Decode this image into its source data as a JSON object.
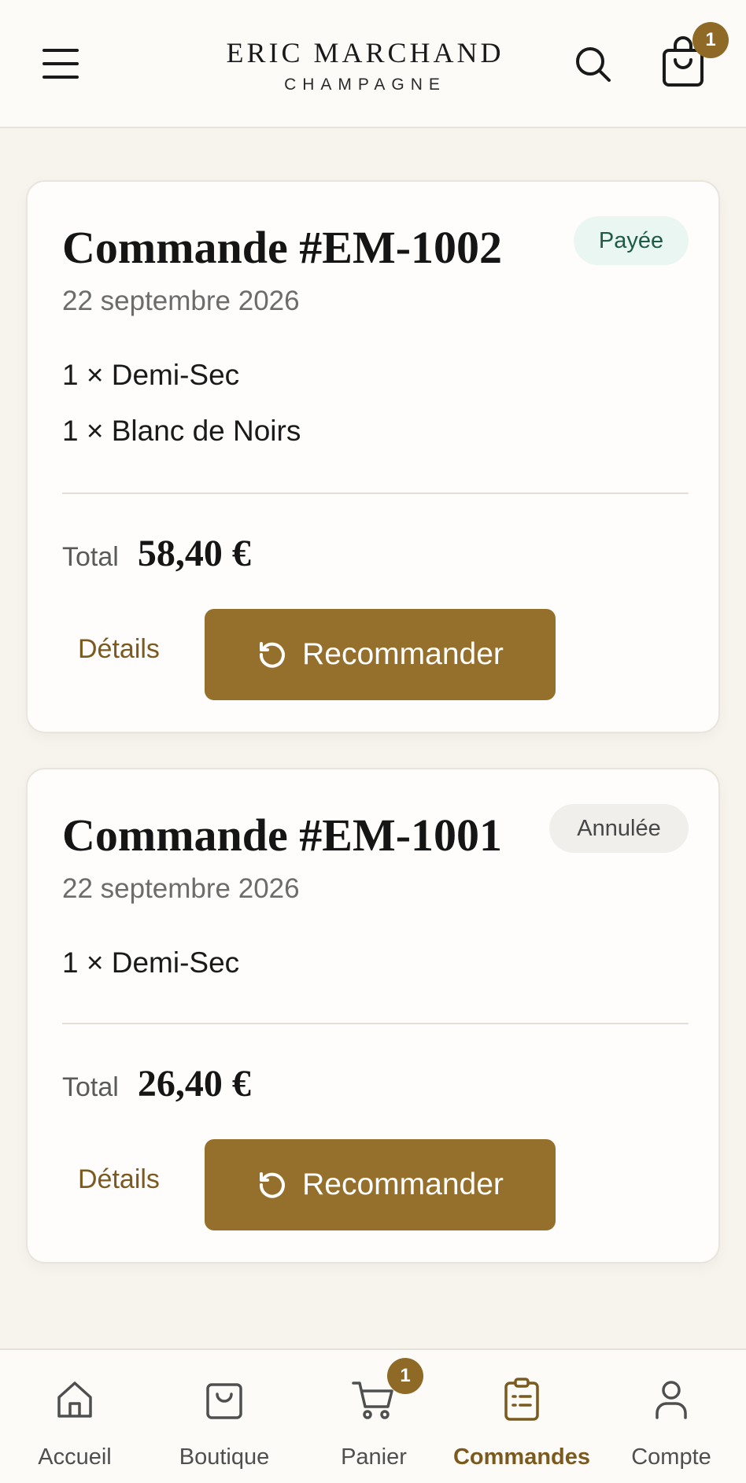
{
  "header": {
    "brand_title": "ERIC MARCHAND",
    "brand_subtitle": "CHAMPAGNE",
    "menu_icon": "hamburger-menu-icon",
    "search_icon": "search-icon",
    "cart_icon": "shopping-bag-icon",
    "cart_count": "1"
  },
  "orders": [
    {
      "title": "Commande #EM-1002",
      "date": "22 septembre 2026",
      "status": "Payée",
      "status_color": "#e9f6f1",
      "items": [
        "1 × Demi-Sec",
        "1 × Blanc de Noirs"
      ],
      "total_label": "Total",
      "total_value": "58,40 €",
      "details_label": "Détails",
      "reorder_label": "Recommander"
    },
    {
      "title": "Commande #EM-1001",
      "date": "22 septembre 2026",
      "status": "Annulée",
      "status_color": "#f0efec",
      "items": [
        "1 × Demi-Sec"
      ],
      "total_label": "Total",
      "total_value": "26,40 €",
      "details_label": "Détails",
      "reorder_label": "Recommander"
    }
  ],
  "bottom_nav": {
    "items": [
      {
        "label": "Accueil",
        "icon": "home-icon",
        "active": false
      },
      {
        "label": "Boutique",
        "icon": "shopping-bag-icon",
        "active": false
      },
      {
        "label": "Panier",
        "icon": "cart-icon",
        "active": false,
        "badge": "1"
      },
      {
        "label": "Commandes",
        "icon": "clipboard-list-icon",
        "active": true
      },
      {
        "label": "Compte",
        "icon": "user-icon",
        "active": false
      }
    ]
  },
  "colors": {
    "accent": "#95702c",
    "accent_text": "#7a5a1e",
    "background": "#f7f4ee"
  }
}
